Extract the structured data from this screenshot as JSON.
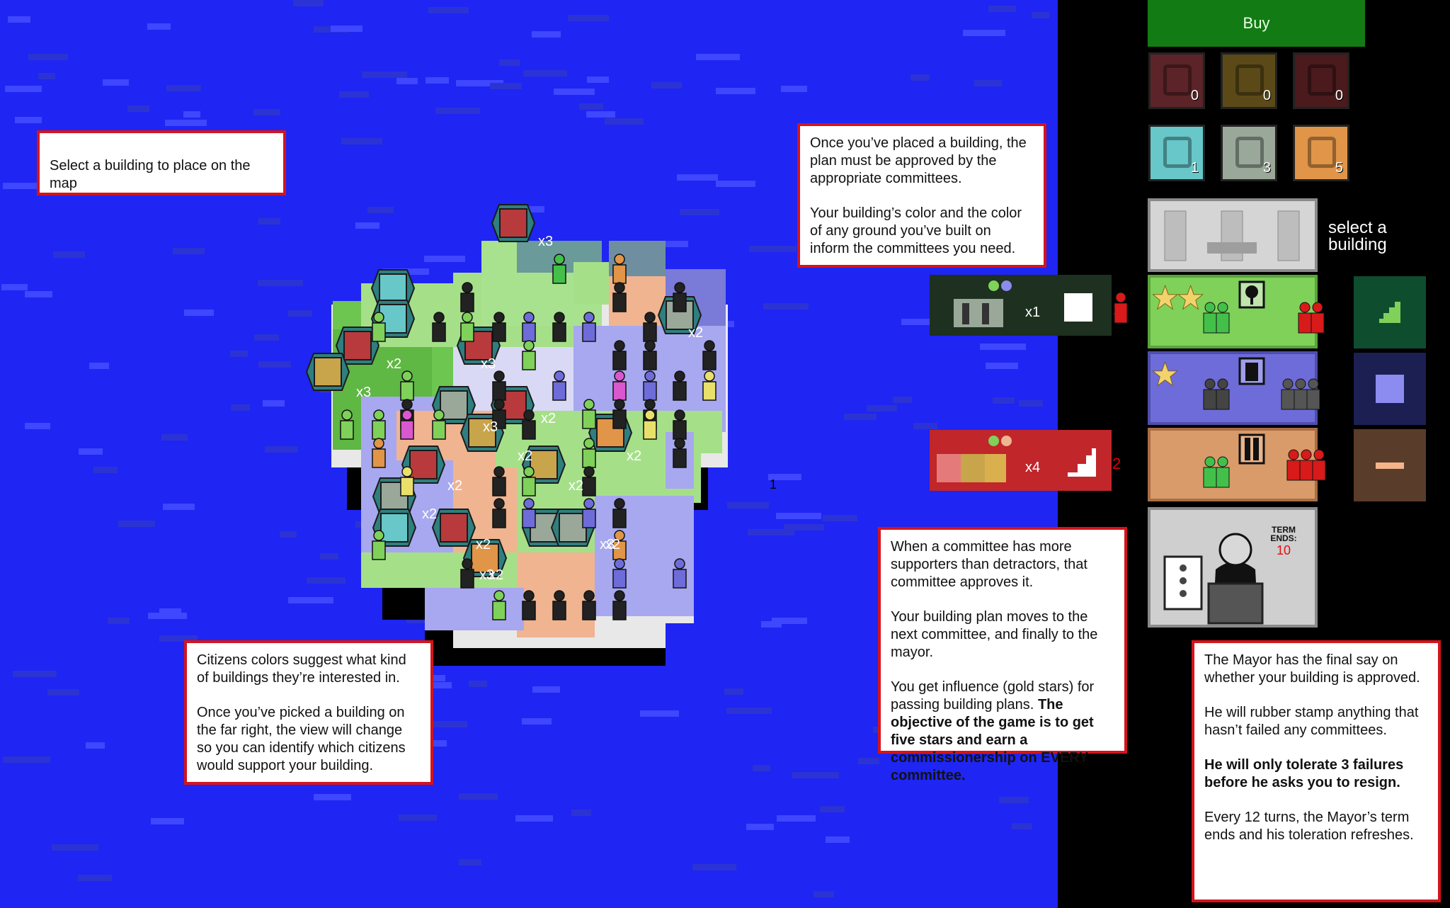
{
  "buy_button": {
    "label": "Buy"
  },
  "resources_top": [
    {
      "icon": "media-icon",
      "count": "0",
      "color": "#5c2428"
    },
    {
      "icon": "fist-icon",
      "count": "0",
      "color": "#5b4a18"
    },
    {
      "icon": "no-sign-icon",
      "count": "0",
      "color": "#4a1a1c"
    }
  ],
  "resources_bottom": [
    {
      "icon": "turn-arrow-icon",
      "count": "1",
      "color": "#67c7c9"
    },
    {
      "icon": "suit-person-icon",
      "count": "3",
      "color": "#9aa89a"
    },
    {
      "icon": "stamp-icon",
      "count": "5",
      "color": "#e09548"
    }
  ],
  "select_building_label": "select a building",
  "committees": [
    {
      "name": "green",
      "color": "#7fd15a",
      "swatch_icon": "stairs-icon",
      "swatch_color": "#0f4d2f"
    },
    {
      "name": "blue",
      "color": "#6e6cd9",
      "swatch_icon": "square-icon",
      "swatch_color": "#1c1f52"
    },
    {
      "name": "orange",
      "color": "#d99b6a",
      "swatch_icon": "dash-icon",
      "swatch_color": "#5a3c2a"
    }
  ],
  "building_plans": [
    {
      "multiplier": "x1",
      "color": "#1e3020",
      "index": "1"
    },
    {
      "multiplier": "x4",
      "color": "#c0262a",
      "index": "2"
    }
  ],
  "mayor_term": {
    "label_line1": "TERM",
    "label_line2": "ENDS:",
    "value": "10"
  },
  "map_marker": "1",
  "map_multipliers": [
    "x3",
    "x2",
    "x2",
    "x3",
    "x3",
    "x3",
    "x2",
    "x2",
    "x2",
    "x2",
    "x2",
    "x2",
    "x2",
    "x2",
    "x2",
    "x3",
    "x3"
  ],
  "tips": {
    "select": "Select a building to place on the map",
    "approval": [
      "Once you’ve placed a building, the plan must be approved by the appropriate committees.",
      "Your building’s color and the color of any ground you’ve built on inform the committees you need."
    ],
    "citizens": [
      "Citizens colors suggest what kind of buildings they’re interested in.",
      "Once you’ve picked a building on the far right, the view will change so you can identify which citizens would support your building."
    ],
    "committee": [
      "When a committee has more supporters than detractors, that committee approves it.",
      "Your building plan moves to the next committee, and finally to the mayor.",
      "You get influence (gold stars) for passing building plans."
    ],
    "committee_bold": "The objective of the game is to get five stars and earn a commissionership on EVERY committee.",
    "mayor": [
      "The Mayor has the final say on whether your building is approved.",
      "He will rubber stamp anything that hasn’t failed any committees."
    ],
    "mayor_bold": "He will only tolerate 3 failures before he asks you to resign.",
    "mayor_last": "Every 12 turns, the Mayor’s term ends and his toleration refreshes."
  }
}
